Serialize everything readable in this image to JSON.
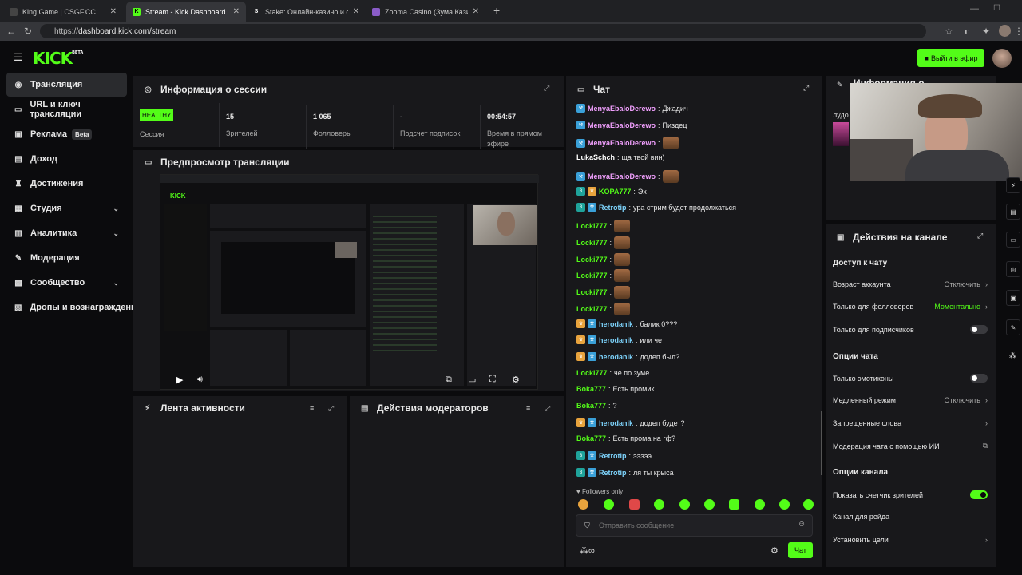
{
  "browser": {
    "tabs": [
      {
        "title": "King Game | CSGF.CC",
        "active": false
      },
      {
        "title": "Stream - Kick Dashboard",
        "active": true
      },
      {
        "title": "Stake: Онлайн-казино и ставки н",
        "active": false
      },
      {
        "title": "Zooma Casino (Зума Казино) офи",
        "active": false
      }
    ],
    "url_prefix": "https://",
    "url_main": "dashboard.kick.com/stream"
  },
  "header": {
    "logo": "KICK",
    "logo_beta": "BETA",
    "go_live": "Выйти в эфир"
  },
  "sidebar": {
    "items": [
      {
        "label": "Трансляция",
        "icon": "broadcast-icon"
      },
      {
        "label": "URL и ключ трансляции",
        "icon": "link-icon"
      },
      {
        "label": "Реклама",
        "icon": "ad-icon",
        "badge": "Beta"
      },
      {
        "label": "Доход",
        "icon": "money-icon"
      },
      {
        "label": "Достижения",
        "icon": "trophy-icon"
      },
      {
        "label": "Студия",
        "icon": "grid-icon"
      },
      {
        "label": "Аналитика",
        "icon": "chart-icon"
      },
      {
        "label": "Модерация",
        "icon": "wrench-icon"
      },
      {
        "label": "Сообщество",
        "icon": "people-icon"
      },
      {
        "label": "Дропы и вознаграждени",
        "icon": "gift-icon"
      }
    ]
  },
  "session": {
    "title": "Информация о сессии",
    "health": "HEALTHY",
    "health_label": "Сессия",
    "viewers": "15",
    "viewers_label": "Зрителей",
    "followers": "1 065",
    "followers_label": "Фолловеры",
    "subs": "-",
    "subs_label": "Подсчет подписок",
    "uptime": "00:54:57",
    "uptime_label": "Время в прямом эфире"
  },
  "preview": {
    "title": "Предпросмотр трансляции"
  },
  "activity": {
    "title": "Лента активности"
  },
  "modactions": {
    "title": "Действия модераторов"
  },
  "chat": {
    "title": "Чат",
    "messages": [
      {
        "user": "MenyaEbaloDerewo",
        "text": "Джадич",
        "color": "#f2a0ff",
        "badges": [
          "kick"
        ],
        "emote": false
      },
      {
        "user": "MenyaEbaloDerewo",
        "text": "Пиздец",
        "color": "#f2a0ff",
        "badges": [
          "kick"
        ],
        "emote": false
      },
      {
        "user": "MenyaEbaloDerewo",
        "text": "",
        "color": "#f2a0ff",
        "badges": [
          "kick"
        ],
        "emote": true
      },
      {
        "user": "LukaSchch",
        "text": "ща твой вин)",
        "color": "#ffffff",
        "badges": [],
        "emote": false
      },
      {
        "user": "MenyaEbaloDerewo",
        "text": "",
        "color": "#f2a0ff",
        "badges": [
          "kick"
        ],
        "emote": true
      },
      {
        "user": "KOPA777",
        "text": "Эх",
        "color": "#53fc18",
        "badges": [
          "sub",
          "crown"
        ],
        "emote": false
      },
      {
        "user": "Retrotip",
        "text": "ура стрим будет продолжаться",
        "color": "#7dd3fc",
        "badges": [
          "sub",
          "kick"
        ],
        "emote": false
      },
      {
        "user": "Locki777",
        "text": "",
        "color": "#53fc18",
        "badges": [],
        "emote": true
      },
      {
        "user": "Locki777",
        "text": "",
        "color": "#53fc18",
        "badges": [],
        "emote": true
      },
      {
        "user": "Locki777",
        "text": "",
        "color": "#53fc18",
        "badges": [],
        "emote": true
      },
      {
        "user": "Locki777",
        "text": "",
        "color": "#53fc18",
        "badges": [],
        "emote": true
      },
      {
        "user": "Locki777",
        "text": "",
        "color": "#53fc18",
        "badges": [],
        "emote": true
      },
      {
        "user": "Locki777",
        "text": "",
        "color": "#53fc18",
        "badges": [],
        "emote": true
      },
      {
        "user": "herodanik",
        "text": "балик 0???",
        "color": "#7dd3fc",
        "badges": [
          "crown",
          "kick"
        ],
        "emote": false
      },
      {
        "user": "herodanik",
        "text": "или че",
        "color": "#7dd3fc",
        "badges": [
          "crown",
          "kick"
        ],
        "emote": false
      },
      {
        "user": "herodanik",
        "text": "додеп был?",
        "color": "#7dd3fc",
        "badges": [
          "crown",
          "kick"
        ],
        "emote": false
      },
      {
        "user": "Locki777",
        "text": "че по зуме",
        "color": "#53fc18",
        "badges": [],
        "emote": false
      },
      {
        "user": "Boka777",
        "text": "Есть промик",
        "color": "#53fc18",
        "badges": [],
        "emote": false
      },
      {
        "user": "Boka777",
        "text": "?",
        "color": "#53fc18",
        "badges": [],
        "emote": false
      },
      {
        "user": "herodanik",
        "text": "додеп будет?",
        "color": "#7dd3fc",
        "badges": [
          "crown",
          "kick"
        ],
        "emote": false
      },
      {
        "user": "Boka777",
        "text": "Есть прома на гф?",
        "color": "#53fc18",
        "badges": [],
        "emote": false
      },
      {
        "user": "Retrotip",
        "text": "эээээ",
        "color": "#7dd3fc",
        "badges": [
          "sub",
          "kick"
        ],
        "emote": false
      },
      {
        "user": "Retrotip",
        "text": "ля ты крыса",
        "color": "#7dd3fc",
        "badges": [
          "sub",
          "kick"
        ],
        "emote": false
      }
    ],
    "followers_only": "Followers only",
    "placeholder": "Отправить сообщение",
    "send": "Чат"
  },
  "actions": {
    "info_title": "Информация о",
    "info_text": "лудо",
    "title": "Действия на канале",
    "access": "Доступ к чату",
    "account_age": "Возраст аккаунта",
    "account_age_val": "Отключить",
    "followers_only": "Только для фолловеров",
    "followers_only_val": "Моментально",
    "subs_only": "Только для подписчиков",
    "chat_options": "Опции чата",
    "emotes_only": "Только эмотиконы",
    "slow_mode": "Медленный режим",
    "slow_mode_val": "Отключить",
    "banned_words": "Запрещенные слова",
    "ai_mod": "Модерация чата с помощью ИИ",
    "channel_options": "Опции канала",
    "show_viewers": "Показать счетчик зрителей",
    "raid_channel": "Канал для рейда",
    "set_goals": "Установить цели"
  },
  "colors": {
    "accent": "#53fc18",
    "panel": "#18181b",
    "bg": "#0b0b0d"
  }
}
